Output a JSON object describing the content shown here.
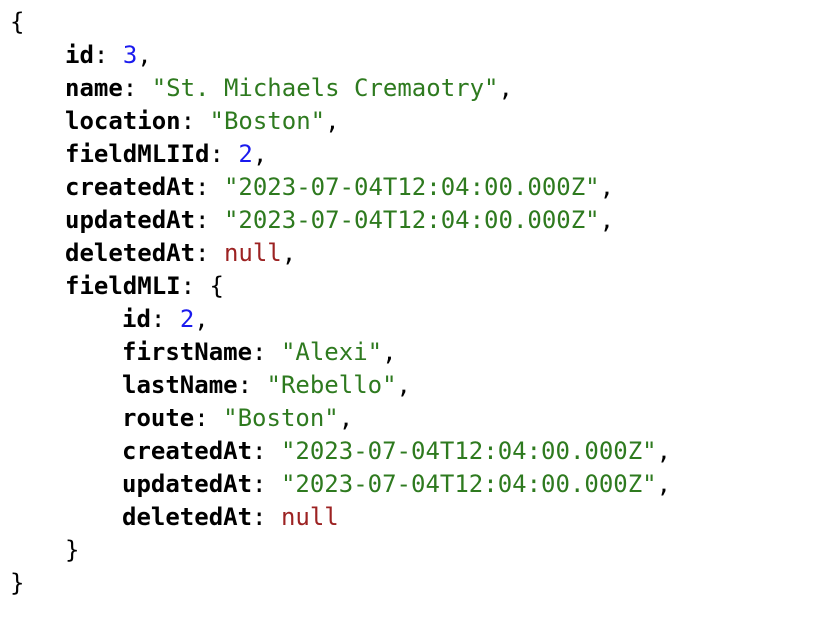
{
  "viewer": {
    "open_brace": "{",
    "close_brace": "}",
    "toggle_glyph": "▼",
    "colors": {
      "string": "#2e7a1f",
      "number": "#1a1aee",
      "null": "#9c2222",
      "key": "#000000"
    },
    "root": [
      {
        "key": "id",
        "value": "3",
        "type": "number",
        "comma": ","
      },
      {
        "key": "name",
        "value": "\"St. Michaels Cremaotry\"",
        "type": "string",
        "comma": ","
      },
      {
        "key": "location",
        "value": "\"Boston\"",
        "type": "string",
        "comma": ","
      },
      {
        "key": "fieldMLIId",
        "value": "2",
        "type": "number",
        "comma": ","
      },
      {
        "key": "createdAt",
        "value": "\"2023-07-04T12:04:00.000Z\"",
        "type": "string",
        "comma": ","
      },
      {
        "key": "updatedAt",
        "value": "\"2023-07-04T12:04:00.000Z\"",
        "type": "string",
        "comma": ","
      },
      {
        "key": "deletedAt",
        "value": "null",
        "type": "null",
        "comma": ","
      }
    ],
    "nested": {
      "key": "fieldMLI",
      "open": "{",
      "close": "}",
      "fields": [
        {
          "key": "id",
          "value": "2",
          "type": "number",
          "comma": ","
        },
        {
          "key": "firstName",
          "value": "\"Alexi\"",
          "type": "string",
          "comma": ","
        },
        {
          "key": "lastName",
          "value": "\"Rebello\"",
          "type": "string",
          "comma": ","
        },
        {
          "key": "route",
          "value": "\"Boston\"",
          "type": "string",
          "comma": ","
        },
        {
          "key": "createdAt",
          "value": "\"2023-07-04T12:04:00.000Z\"",
          "type": "string",
          "comma": ","
        },
        {
          "key": "updatedAt",
          "value": "\"2023-07-04T12:04:00.000Z\"",
          "type": "string",
          "comma": ","
        },
        {
          "key": "deletedAt",
          "value": "null",
          "type": "null",
          "comma": ""
        }
      ]
    }
  }
}
